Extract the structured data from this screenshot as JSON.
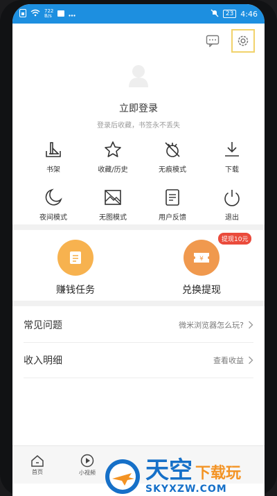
{
  "status_bar": {
    "speed_top": "722",
    "speed_bottom": "B/s",
    "battery": "23",
    "time": "4:46"
  },
  "login": {
    "title": "立即登录",
    "subtitle": "登录后收藏，书签永不丢失"
  },
  "grid": [
    {
      "icon": "bookshelf-icon",
      "label": "书架"
    },
    {
      "icon": "star-icon",
      "label": "收藏/历史"
    },
    {
      "icon": "incognito-icon",
      "label": "无痕模式"
    },
    {
      "icon": "download-icon",
      "label": "下载"
    },
    {
      "icon": "moon-icon",
      "label": "夜间模式"
    },
    {
      "icon": "no-image-icon",
      "label": "无图模式"
    },
    {
      "icon": "feedback-icon",
      "label": "用户反馈"
    },
    {
      "icon": "power-icon",
      "label": "退出"
    }
  ],
  "tasks": {
    "earn": {
      "label": "赚钱任务",
      "icon": "task-list-icon",
      "color": "#f7b24f"
    },
    "withdraw": {
      "label": "兑换提现",
      "icon": "coupon-icon",
      "badge": "提现10元",
      "color": "#f0994e"
    }
  },
  "list": [
    {
      "title": "常见问题",
      "right": "微米浏览器怎么玩?"
    },
    {
      "title": "收入明细",
      "right": "查看收益"
    }
  ],
  "bottom_nav": [
    {
      "icon": "home-icon",
      "label": "首页"
    },
    {
      "icon": "video-icon",
      "label": "小视频"
    }
  ],
  "watermark": {
    "cn_main": "天空",
    "cn_sub": "下载玩",
    "en": "SKYXZW.COM"
  },
  "colors": {
    "status_bar": "#1d8fe0",
    "highlight": "#f1d26a",
    "badge": "#ea4b3c"
  }
}
